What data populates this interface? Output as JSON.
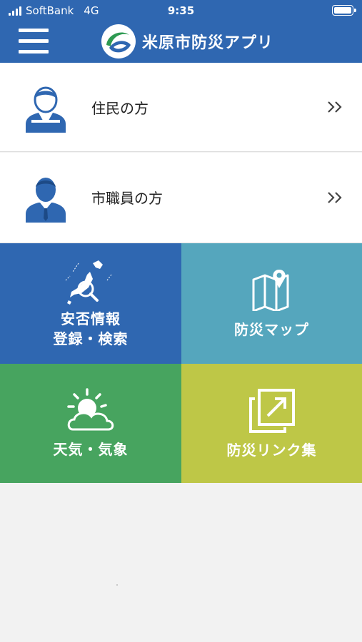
{
  "status_bar": {
    "carrier": "SoftBank",
    "network": "4G",
    "time": "9:35"
  },
  "header": {
    "title": "米原市防災アプリ",
    "menu_icon": "hamburger-menu-icon",
    "logo_icon": "city-logo-icon"
  },
  "menu_rows": [
    {
      "label": "住民の方",
      "icon": "resident-person-icon"
    },
    {
      "label": "市職員の方",
      "icon": "staff-person-icon"
    }
  ],
  "tiles": [
    {
      "line1": "安否情報",
      "line2": "登録・検索",
      "icon": "japan-map-search-icon",
      "color": "#2f67b1"
    },
    {
      "label": "防災マップ",
      "icon": "map-pin-icon",
      "color": "#55a6bd"
    },
    {
      "label": "天気・気象",
      "icon": "sun-cloud-icon",
      "color": "#47a45f"
    },
    {
      "label": "防災リンク集",
      "icon": "external-link-icon",
      "color": "#bec747"
    }
  ],
  "colors": {
    "header_blue": "#2f67b1",
    "icon_blue": "#2f67b1",
    "background": "#f2f2f2"
  }
}
